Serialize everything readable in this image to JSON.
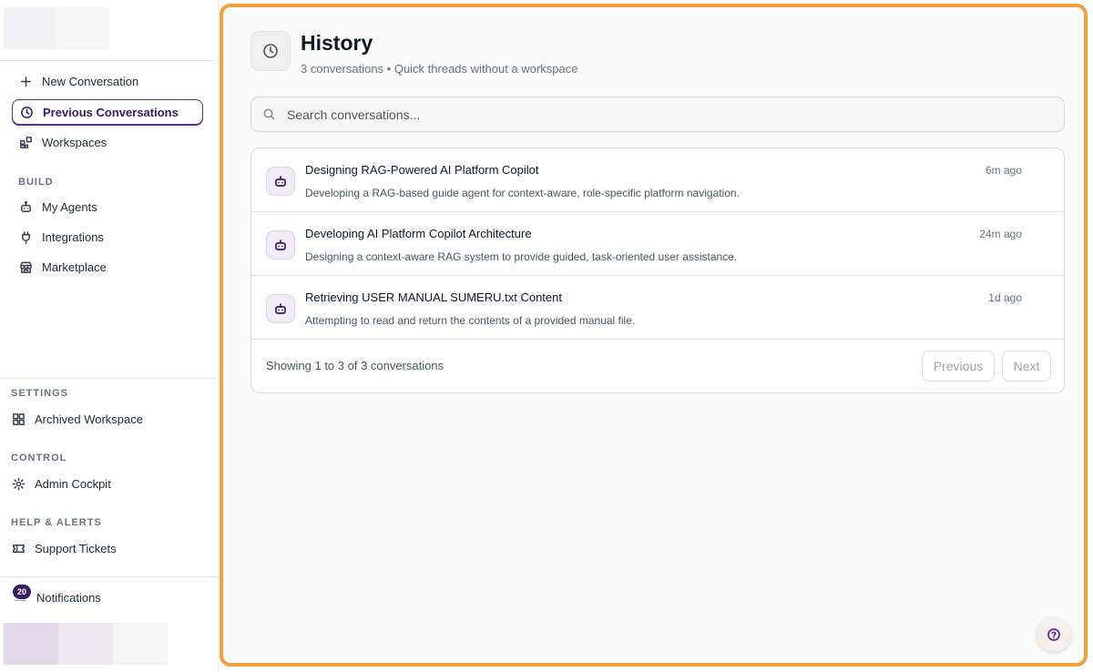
{
  "colors": {
    "accent": "#3b1a63",
    "highlight_border": "#f0a040",
    "logo_block_1": "#f1f1f3",
    "logo_block_2": "#f6f6f7",
    "bottom_block_1": "#e2d9e8",
    "bottom_block_2": "#efe9f2",
    "bottom_block_3": "#f6f6f7"
  },
  "sidebar": {
    "nav": [
      {
        "label": "New Conversation",
        "icon": "plus-icon"
      },
      {
        "label": "Previous Conversations",
        "icon": "clock-icon",
        "active": true
      },
      {
        "label": "Workspaces",
        "icon": "workspaces-icon"
      }
    ],
    "build_label": "BUILD",
    "build": [
      {
        "label": "My Agents",
        "icon": "bot-icon"
      },
      {
        "label": "Integrations",
        "icon": "plug-icon"
      },
      {
        "label": "Marketplace",
        "icon": "store-icon"
      }
    ],
    "settings_label": "SETTINGS",
    "settings": [
      {
        "label": "Archived Workspace",
        "icon": "grid-icon"
      }
    ],
    "control_label": "CONTROL",
    "control": [
      {
        "label": "Admin Cockpit",
        "icon": "gear-icon"
      }
    ],
    "help_label": "HELP & ALERTS",
    "help": [
      {
        "label": "Support Tickets",
        "icon": "ticket-icon"
      }
    ],
    "notifications": {
      "label": "Notifications",
      "count": "20",
      "icon": "bell-icon"
    }
  },
  "main": {
    "title": "History",
    "subtitle": "3 conversations • Quick threads without a workspace",
    "search_placeholder": "Search conversations...",
    "conversations": [
      {
        "title": "Designing RAG-Powered AI Platform Copilot",
        "description": "Developing a RAG-based guide agent for context-aware, role-specific platform navigation.",
        "time": "6m ago",
        "icon": "bot-icon"
      },
      {
        "title": "Developing AI Platform Copilot Architecture",
        "description": "Designing a context-aware RAG system to provide guided, task-oriented user assistance.",
        "time": "24m ago",
        "icon": "bot-icon"
      },
      {
        "title": "Retrieving USER MANUAL SUMERU.txt Content",
        "description": "Attempting to read and return the contents of a provided manual file.",
        "time": "1d ago",
        "icon": "bot-icon"
      }
    ],
    "pagination": {
      "summary": "Showing 1 to 3 of 3 conversations",
      "previous": "Previous",
      "next": "Next"
    }
  }
}
